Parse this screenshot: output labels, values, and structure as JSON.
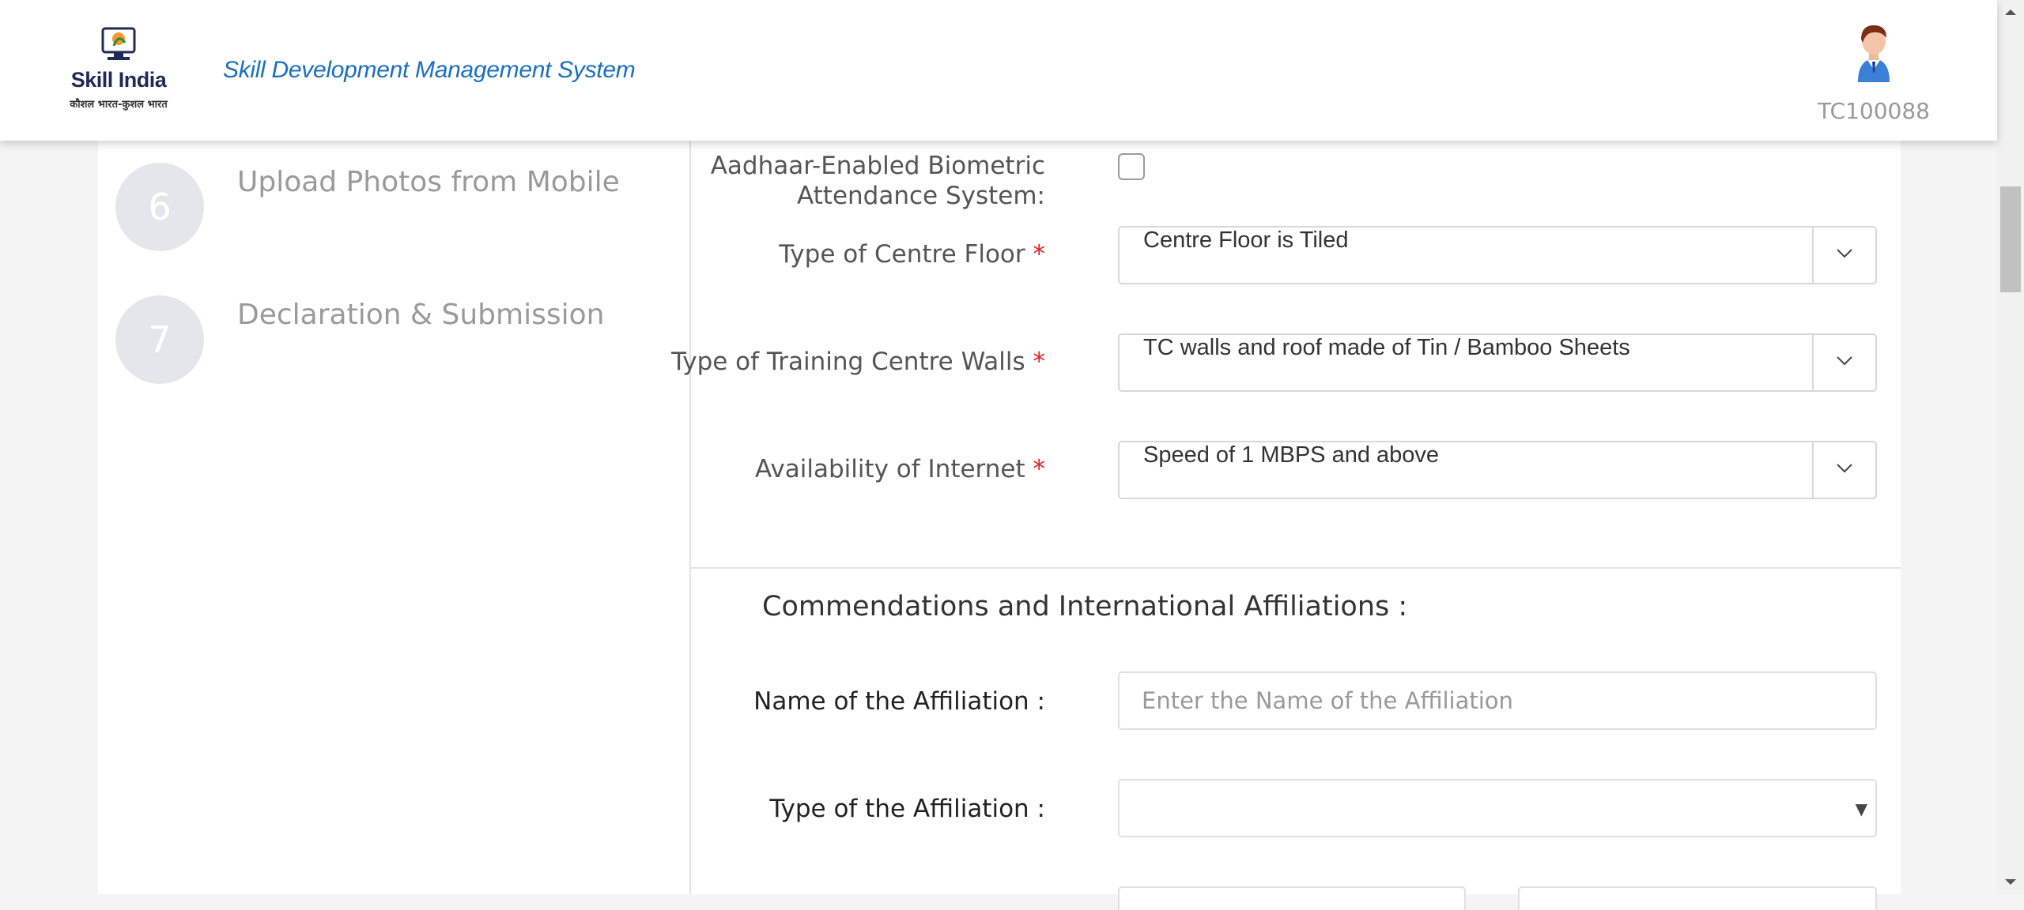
{
  "header": {
    "logo_title": "Skill India",
    "logo_subtitle": "कौशल भारत-कुशल भारत",
    "app_title": "Skill Development Management System",
    "user_id": "TC100088"
  },
  "steps": [
    {
      "number": "6",
      "label": "Upload Photos from Mobile"
    },
    {
      "number": "7",
      "label": "Declaration & Submission"
    }
  ],
  "form": {
    "biometric": {
      "label_line1": "Aadhaar-Enabled Biometric",
      "label_line2": "Attendance System:",
      "checked": false
    },
    "floor": {
      "label": "Type of Centre Floor",
      "required": "*",
      "value": "Centre Floor is Tiled"
    },
    "walls": {
      "label": "Type of Training Centre Walls",
      "required": "*",
      "value": "TC walls and roof made of Tin / Bamboo Sheets"
    },
    "internet": {
      "label": "Availability of Internet",
      "required": "*",
      "value": "Speed of 1 MBPS and above"
    }
  },
  "affiliations": {
    "section_title": "Commendations and International Affiliations :",
    "name_label": "Name of the Affiliation :",
    "name_placeholder": "Enter the Name of the Affiliation",
    "name_value": "",
    "type_label": "Type of the Affiliation :",
    "type_value": ""
  },
  "colors": {
    "accent": "#1a6fc0",
    "required": "#e02020",
    "muted_text": "#9a9a9a",
    "step_circle": "#e4e6ec"
  },
  "icons": [
    "logo-icon",
    "user-avatar-icon",
    "chevron-down-icon",
    "caret-down-icon",
    "scroll-up-arrow-icon",
    "scroll-down-arrow-icon"
  ]
}
